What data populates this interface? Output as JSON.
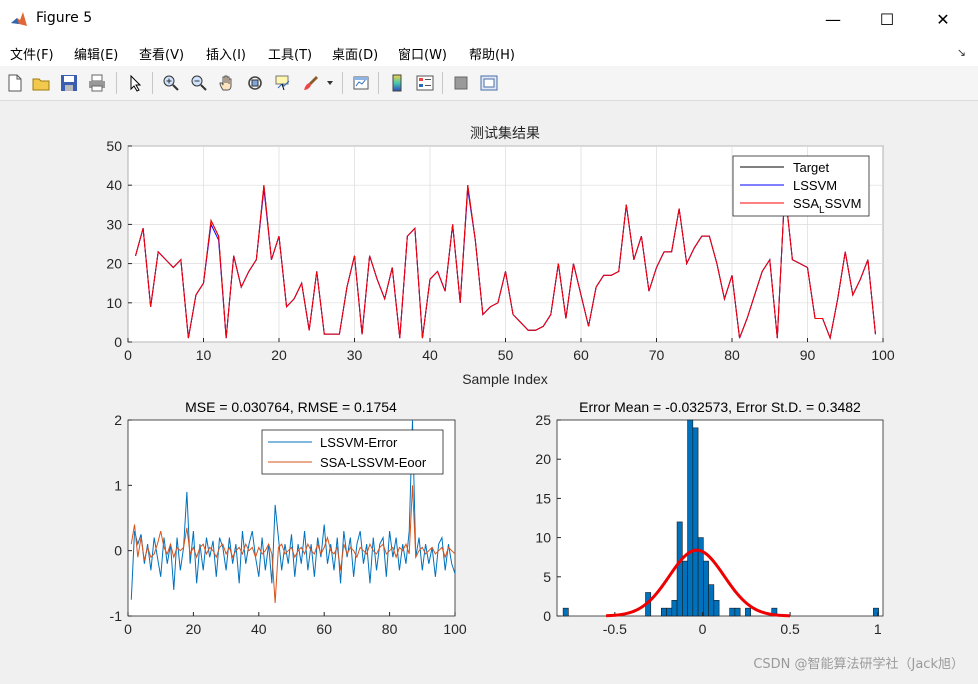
{
  "window": {
    "title": "Figure 5",
    "controls": {
      "minimize": "—",
      "maximize": "☐",
      "close": "✕"
    }
  },
  "menu": {
    "items": [
      "文件(F)",
      "编辑(E)",
      "查看(V)",
      "插入(I)",
      "工具(T)",
      "桌面(D)",
      "窗口(W)",
      "帮助(H)"
    ],
    "corner_glyph": "↘"
  },
  "toolbar": {
    "icons": [
      "new-figure-icon",
      "open-file-icon",
      "save-icon",
      "print-icon",
      "select-arrow-icon",
      "zoom-in-icon",
      "zoom-out-icon",
      "pan-hand-icon",
      "rotate-3d-icon",
      "data-cursor-icon",
      "brush-icon",
      "brush-dropdown-icon",
      "link-plot-icon",
      "colorbar-icon",
      "legend-icon",
      "hide-plot-tools-icon",
      "show-plot-tools-icon"
    ]
  },
  "watermark": "CSDN @智能算法研学社（Jack旭）",
  "colors": {
    "target": "#000000",
    "lssvm": "#0000ff",
    "ssa": "#ff0000",
    "err1": "#0072bd",
    "err2": "#d95319",
    "hist": "#0072bd",
    "fit": "#ee0000"
  },
  "chart_data": [
    {
      "type": "line",
      "title": "测试集结果",
      "xlabel": "Sample Index",
      "ylabel": "",
      "xlim": [
        0,
        100
      ],
      "ylim": [
        0,
        50
      ],
      "xticks": [
        0,
        10,
        20,
        30,
        40,
        50,
        60,
        70,
        80,
        90,
        100
      ],
      "yticks": [
        0,
        10,
        20,
        30,
        40,
        50
      ],
      "grid": true,
      "legend": {
        "position": "top-right",
        "entries": [
          "Target",
          "LSSVM",
          "SSA",
          "SSVM"
        ],
        "subscript": "L"
      },
      "x": [
        1,
        2,
        3,
        4,
        5,
        6,
        7,
        8,
        9,
        10,
        11,
        12,
        13,
        14,
        15,
        16,
        17,
        18,
        19,
        20,
        21,
        22,
        23,
        24,
        25,
        26,
        27,
        28,
        29,
        30,
        31,
        32,
        33,
        34,
        35,
        36,
        37,
        38,
        39,
        40,
        41,
        42,
        43,
        44,
        45,
        46,
        47,
        48,
        49,
        50,
        51,
        52,
        53,
        54,
        55,
        56,
        57,
        58,
        59,
        60,
        61,
        62,
        63,
        64,
        65,
        66,
        67,
        68,
        69,
        70,
        71,
        72,
        73,
        74,
        75,
        76,
        77,
        78,
        79,
        80,
        81,
        82,
        83,
        84,
        85,
        86,
        87,
        88,
        89,
        90,
        91,
        92,
        93,
        94,
        95,
        96,
        97,
        98,
        99,
        100
      ],
      "series": [
        {
          "name": "Target",
          "values": [
            22,
            29,
            9,
            23,
            21,
            19,
            21,
            1,
            12,
            15,
            31,
            27,
            1,
            22,
            14,
            18,
            21,
            40,
            21,
            27,
            9,
            11,
            15,
            3,
            18,
            2,
            2,
            2,
            14,
            22,
            2,
            22,
            16,
            11,
            19,
            1,
            27,
            29,
            1,
            16,
            18,
            13,
            30,
            10,
            40,
            26,
            7,
            9,
            10,
            18,
            7,
            5,
            3,
            3,
            4,
            7,
            20,
            6,
            20,
            12,
            4,
            14,
            17,
            17,
            18,
            35,
            21,
            27,
            13,
            19,
            23,
            23,
            34,
            20,
            24,
            27,
            27,
            20,
            11,
            17,
            1,
            6,
            12,
            18,
            21,
            1,
            39,
            21,
            20,
            19,
            6,
            6,
            1,
            11,
            23,
            12,
            16,
            21,
            2
          ],
          "note_x_offset": 0
        },
        {
          "name": "LSSVM",
          "values": [
            22,
            29,
            9,
            23,
            21,
            19,
            21,
            1,
            12,
            15,
            30,
            26,
            1,
            22,
            14,
            18,
            21,
            39,
            21,
            27,
            9,
            11,
            15,
            3,
            18,
            2,
            2,
            2,
            14,
            22,
            2,
            22,
            16,
            11,
            19,
            1,
            27,
            29,
            1,
            16,
            18,
            13,
            30,
            10,
            39,
            26,
            7,
            9,
            10,
            18,
            7,
            5,
            3,
            3,
            4,
            7,
            20,
            6,
            20,
            12,
            4,
            14,
            17,
            17,
            18,
            35,
            21,
            27,
            13,
            19,
            23,
            23,
            34,
            20,
            24,
            27,
            27,
            20,
            11,
            17,
            1,
            6,
            12,
            18,
            21,
            1,
            39,
            21,
            20,
            19,
            6,
            6,
            1,
            11,
            23,
            12,
            16,
            21,
            2
          ]
        },
        {
          "name": "SSA-LSSVM",
          "values": [
            22,
            29,
            9,
            23,
            21,
            19,
            21,
            1,
            12,
            15,
            31,
            27,
            1,
            22,
            14,
            18,
            21,
            40,
            21,
            27,
            9,
            11,
            15,
            3,
            18,
            2,
            2,
            2,
            14,
            22,
            2,
            22,
            16,
            11,
            19,
            1,
            27,
            29,
            1,
            16,
            18,
            13,
            30,
            10,
            40,
            26,
            7,
            9,
            10,
            18,
            7,
            5,
            3,
            3,
            4,
            7,
            20,
            6,
            20,
            12,
            4,
            14,
            17,
            17,
            18,
            35,
            21,
            27,
            13,
            19,
            23,
            23,
            34,
            20,
            24,
            27,
            27,
            20,
            11,
            17,
            1,
            6,
            12,
            18,
            21,
            1,
            39,
            21,
            20,
            19,
            6,
            6,
            1,
            11,
            23,
            12,
            16,
            21,
            2
          ]
        }
      ]
    },
    {
      "type": "line",
      "title": "MSE = 0.030764, RMSE = 0.1754",
      "xlim": [
        0,
        100
      ],
      "ylim": [
        -1,
        2
      ],
      "xticks": [
        0,
        20,
        40,
        60,
        80,
        100
      ],
      "yticks": [
        -1,
        0,
        1,
        2
      ],
      "legend": {
        "position": "top-right",
        "entries": [
          "LSSVM-Error",
          "SSA-LSSVM-Eoor"
        ]
      },
      "series": [
        {
          "name": "LSSVM-Error",
          "values": [
            -0.75,
            0.3,
            0.1,
            0.25,
            -0.2,
            0.1,
            -0.3,
            0.2,
            -0.1,
            -0.4,
            0.2,
            -0.2,
            0.1,
            -0.6,
            0.2,
            -0.3,
            0.05,
            0.9,
            -0.2,
            0.3,
            -0.5,
            0.1,
            -0.3,
            0.2,
            -0.1,
            0.15,
            -0.4,
            0.2,
            0.05,
            -0.3,
            0.2,
            -0.2,
            0.1,
            -0.5,
            0.3,
            -0.2,
            0.1,
            0.3,
            -0.1,
            -0.4,
            0.2,
            -0.3,
            0.1,
            -0.5,
            0.7,
            0.2,
            -0.3,
            0.1,
            -0.2,
            0.25,
            -0.4,
            0.1,
            -0.2,
            0.3,
            -0.3,
            0.1,
            -0.4,
            0.2,
            -0.1,
            0.4,
            -0.2,
            0.1,
            -0.3,
            0.2,
            -0.5,
            0.3,
            -0.1,
            0.2,
            -0.4,
            0.1,
            0.3,
            -0.2,
            0.1,
            -0.5,
            0.2,
            -0.3,
            0.1,
            0.2,
            -0.4,
            0.3,
            -0.1,
            0.2,
            -0.3,
            0.1,
            -0.2,
            0.3,
            2.0,
            -0.1,
            0.2,
            -0.3,
            0.1,
            -0.2,
            0.05,
            -0.4,
            0.1,
            0.2,
            -0.3,
            0.1,
            -0.2,
            -0.35
          ]
        },
        {
          "name": "SSA-LSSVM-Eoor",
          "values": [
            0.1,
            0.4,
            -0.1,
            0.2,
            -0.15,
            0.05,
            -0.1,
            -0.05,
            0.1,
            0.3,
            0.05,
            -0.05,
            0.1,
            -0.1,
            0.05,
            0.0,
            0.05,
            0.35,
            -0.05,
            0.05,
            -0.1,
            0.05,
            0.1,
            -0.05,
            0.05,
            0.0,
            -0.1,
            0.05,
            0.1,
            -0.05,
            0.05,
            -0.1,
            0.0,
            0.05,
            -0.05,
            0.1,
            0.0,
            0.05,
            -0.1,
            0.05,
            -0.05,
            0.0,
            0.1,
            -0.05,
            -0.8,
            0.05,
            0.1,
            -0.05,
            0.0,
            0.05,
            -0.1,
            0.0,
            0.05,
            -0.05,
            0.1,
            0.0,
            -0.05,
            0.1,
            -0.05,
            0.05,
            0.2,
            0.0,
            -0.05,
            0.05,
            -0.3,
            0.1,
            -0.05,
            0.05,
            0.0,
            -0.1,
            0.05,
            0.0,
            -0.05,
            0.1,
            0.0,
            -0.05,
            0.05,
            0.1,
            -0.05,
            0.0,
            0.05,
            -0.1,
            0.05,
            0.0,
            0.1,
            -0.05,
            1.0,
            -0.1,
            0.0,
            0.05,
            -0.05,
            0.0,
            0.05,
            -0.05,
            0.0,
            0.05,
            -0.1,
            0.05,
            0.0,
            -0.05
          ]
        }
      ]
    },
    {
      "type": "bar",
      "title": "Error Mean = -0.032573, Error St.D. = 0.3482",
      "xlim": [
        -0.83,
        1.03
      ],
      "ylim": [
        0,
        25
      ],
      "xticks": [
        -0.5,
        0,
        0.5,
        1
      ],
      "xticklabels": [
        "-0.5",
        "0",
        "0.5",
        "1"
      ],
      "yticks": [
        0,
        5,
        10,
        15,
        20,
        25
      ],
      "bins": [
        {
          "x": -0.78,
          "count": 1
        },
        {
          "x": -0.31,
          "count": 3
        },
        {
          "x": -0.22,
          "count": 1
        },
        {
          "x": -0.19,
          "count": 1
        },
        {
          "x": -0.16,
          "count": 2
        },
        {
          "x": -0.13,
          "count": 12
        },
        {
          "x": -0.1,
          "count": 7
        },
        {
          "x": -0.07,
          "count": 25
        },
        {
          "x": -0.04,
          "count": 24
        },
        {
          "x": -0.01,
          "count": 10
        },
        {
          "x": 0.02,
          "count": 7
        },
        {
          "x": 0.05,
          "count": 4
        },
        {
          "x": 0.08,
          "count": 2
        },
        {
          "x": 0.17,
          "count": 1
        },
        {
          "x": 0.2,
          "count": 1
        },
        {
          "x": 0.26,
          "count": 1
        },
        {
          "x": 0.41,
          "count": 1
        },
        {
          "x": 0.99,
          "count": 1
        }
      ],
      "bin_width": 0.03,
      "fit": {
        "type": "normal",
        "mean": -0.032573,
        "std": 0.3482,
        "peak": 8.4,
        "xrange": [
          -0.55,
          0.5
        ]
      }
    }
  ]
}
